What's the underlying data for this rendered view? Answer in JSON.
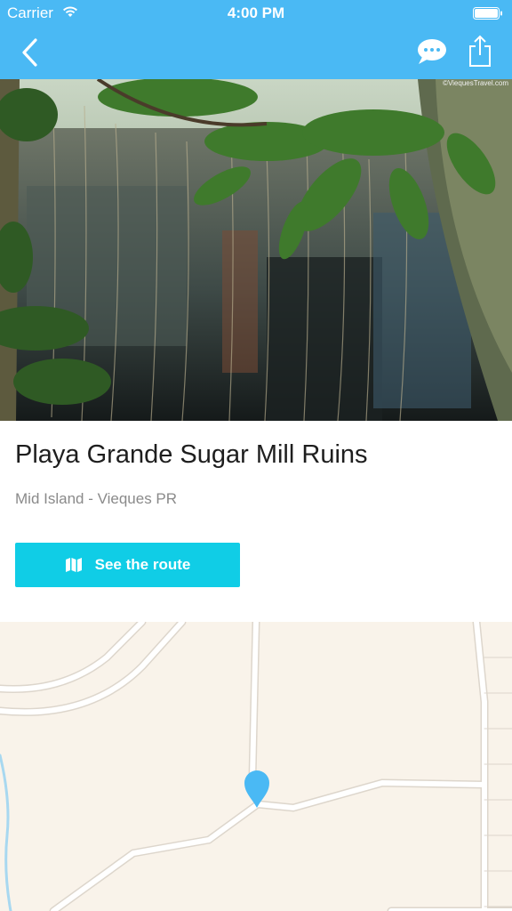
{
  "status_bar": {
    "carrier": "Carrier",
    "time": "4:00 PM"
  },
  "nav": {
    "back_icon": "chevron-left-icon",
    "chat_icon": "speech-bubble-icon",
    "share_icon": "share-icon"
  },
  "hero": {
    "watermark": "©ViequesTravel.com"
  },
  "place": {
    "title": "Playa Grande Sugar Mill Ruins",
    "location": "Mid Island - Vieques PR"
  },
  "route_button": {
    "label": "See the route",
    "icon": "map-icon"
  },
  "colors": {
    "nav_bar": "#4ab9f4",
    "route_button": "#10cde6",
    "map_background": "#f9f3ea",
    "map_pin": "#4ab9f4"
  }
}
